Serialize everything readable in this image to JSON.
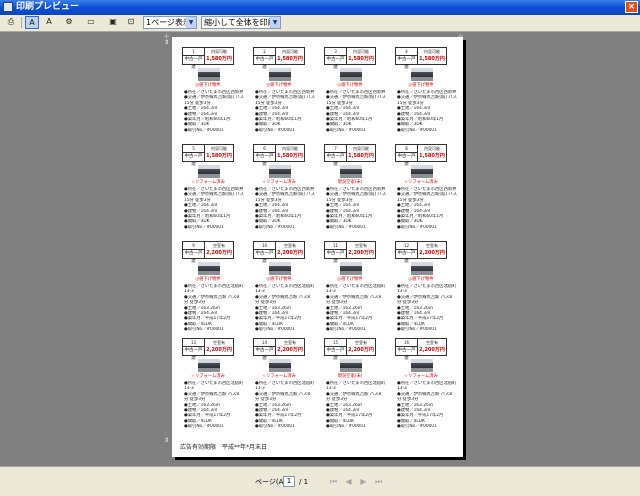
{
  "window": {
    "title": "印刷プレビュー",
    "close_label": "×"
  },
  "toolbar": {
    "print_icon": "printer-icon",
    "font_icon": "font-a-icon",
    "zoom_select": "1ページ表示",
    "fit_select": "縮小して全体を印刷する"
  },
  "page": {
    "footnote": "広告有効期限　平成**年*月末日",
    "listings": [
      {
        "no": "1",
        "bldg": "中古一戸建",
        "type": "内見可能",
        "price": "1,580万円",
        "status": "◎値下げ物件"
      },
      {
        "no": "2",
        "bldg": "中古一戸建",
        "type": "内見可能",
        "price": "1,580万円",
        "status": "◎値下げ物件"
      },
      {
        "no": "3",
        "bldg": "中古一戸建",
        "type": "内見可能",
        "price": "1,580万円",
        "status": "◎値下げ物件"
      },
      {
        "no": "4",
        "bldg": "中古一戸建",
        "type": "内見可能",
        "price": "1,580万円",
        "status": "◎値下げ物件"
      },
      {
        "no": "5",
        "bldg": "中古一戸建",
        "type": "内見可能",
        "price": "1,580万円",
        "status": "☆リフォーム済み"
      },
      {
        "no": "6",
        "bldg": "中古一戸建",
        "type": "内見可能",
        "price": "1,580万円",
        "status": "☆リフォーム済み"
      },
      {
        "no": "7",
        "bldg": "中古一戸建",
        "type": "内見可能",
        "price": "1,580万円",
        "status": "現況空家(未)"
      },
      {
        "no": "8",
        "bldg": "中古一戸建",
        "type": "内見可能",
        "price": "1,580万円",
        "status": "☆リフォーム済み"
      },
      {
        "no": "9",
        "bldg": "中古一戸建",
        "type": "空室有",
        "price": "2,200万円",
        "status": "◎値下げ物件"
      },
      {
        "no": "10",
        "bldg": "中古一戸建",
        "type": "空室有",
        "price": "2,200万円",
        "status": "◎値下げ物件"
      },
      {
        "no": "11",
        "bldg": "中古一戸建",
        "type": "空室有",
        "price": "2,200万円",
        "status": "◎値下げ物件"
      },
      {
        "no": "12",
        "bldg": "中古一戸建",
        "type": "空室有",
        "price": "2,200万円",
        "status": "◎値下げ物件"
      },
      {
        "no": "13",
        "bldg": "中古一戸建",
        "type": "空室有",
        "price": "2,200万円",
        "status": "☆リフォーム済み"
      },
      {
        "no": "14",
        "bldg": "中古一戸建",
        "type": "空室有",
        "price": "2,200万円",
        "status": "☆リフォーム済み"
      },
      {
        "no": "15",
        "bldg": "中古一戸建",
        "type": "空室有",
        "price": "2,200万円",
        "status": "現況空家(未)"
      },
      {
        "no": "16",
        "bldg": "中古一戸建",
        "type": "空室有",
        "price": "2,200万円",
        "status": "☆リフォーム済み"
      }
    ],
    "details_a": [
      "●所在／さいたま市西区西新井",
      "●交通／伊奈線丸吉駅(既) バス",
      "15分 徒歩3分",
      "●土地／164.3㎡",
      "●建物／164.3㎡",
      "●築年月／昭和60年1月",
      "●間取／3DK",
      "●取引No／#00001"
    ],
    "details_b": [
      "●所在／さいたま市西区北宿町",
      "13-3",
      "●交通／伊奈線丸吉駅 バス8",
      "分 徒歩3分",
      "●土地／163.26㎡",
      "●建物／164.3㎡",
      "●築年月／平成17年2月",
      "●間取／4LDK",
      "●取引No／#00001"
    ]
  },
  "statusbar": {
    "page_label": "ページ(A)",
    "page_value": "1",
    "page_total": "/ 1"
  }
}
